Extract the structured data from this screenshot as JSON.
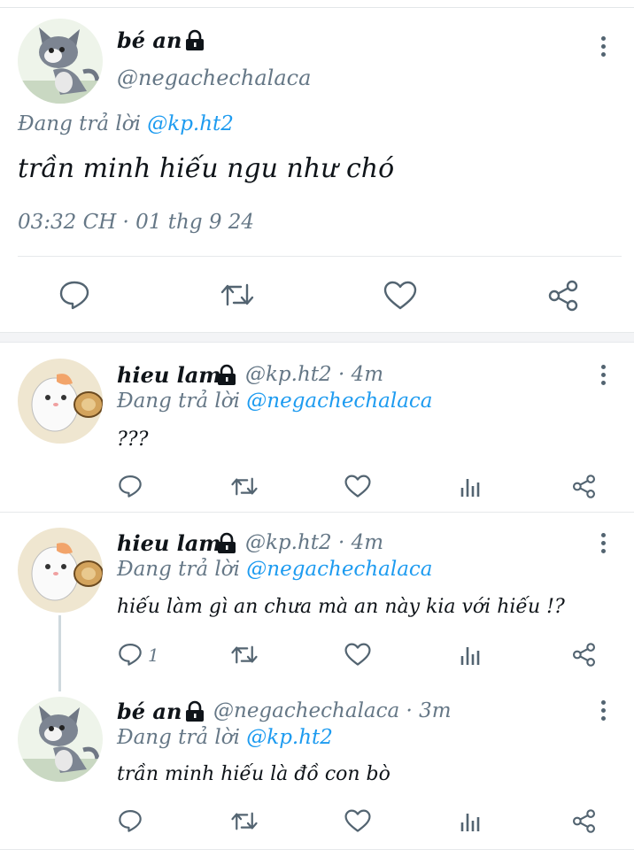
{
  "main_tweet": {
    "display_name": "bé an",
    "handle": "@negachechalaca",
    "reply_prefix": "Đang trả lời",
    "reply_to": "@kp.ht2",
    "text": "trần minh hiếu ngu như chó",
    "timestamp": "03:32 CH · 01 thg 9 24"
  },
  "replies": [
    {
      "display_name": "hieu lam",
      "handle": "@kp.ht2",
      "time": "· 4m",
      "reply_prefix": "Đang trả lời",
      "reply_to": "@negachechalaca",
      "text": "???",
      "reply_count": ""
    },
    {
      "display_name": "hieu lam",
      "handle": "@kp.ht2",
      "time": "· 4m",
      "reply_prefix": "Đang trả lời",
      "reply_to": "@negachechalaca",
      "text": "hiếu làm gì an chưa mà an này kia với hiếu !?",
      "reply_count": "1"
    },
    {
      "display_name": "bé an",
      "handle": "@negachechalaca",
      "time": "· 3m",
      "reply_prefix": "Đang trả lời",
      "reply_to": "@kp.ht2",
      "text": "trần minh hiếu là đồ con bò",
      "reply_count": ""
    }
  ],
  "icons": {
    "reply": "speech-bubble-icon",
    "retweet": "retweet-arrows-icon",
    "like": "heart-icon",
    "views": "bar-chart-icon",
    "share": "share-nodes-icon",
    "more": "vertical-dots-icon",
    "lock": "padlock-icon"
  },
  "colors": {
    "link": "#1d9bf0",
    "muted": "#657786",
    "icon": "#536471",
    "text": "#0f1419"
  }
}
